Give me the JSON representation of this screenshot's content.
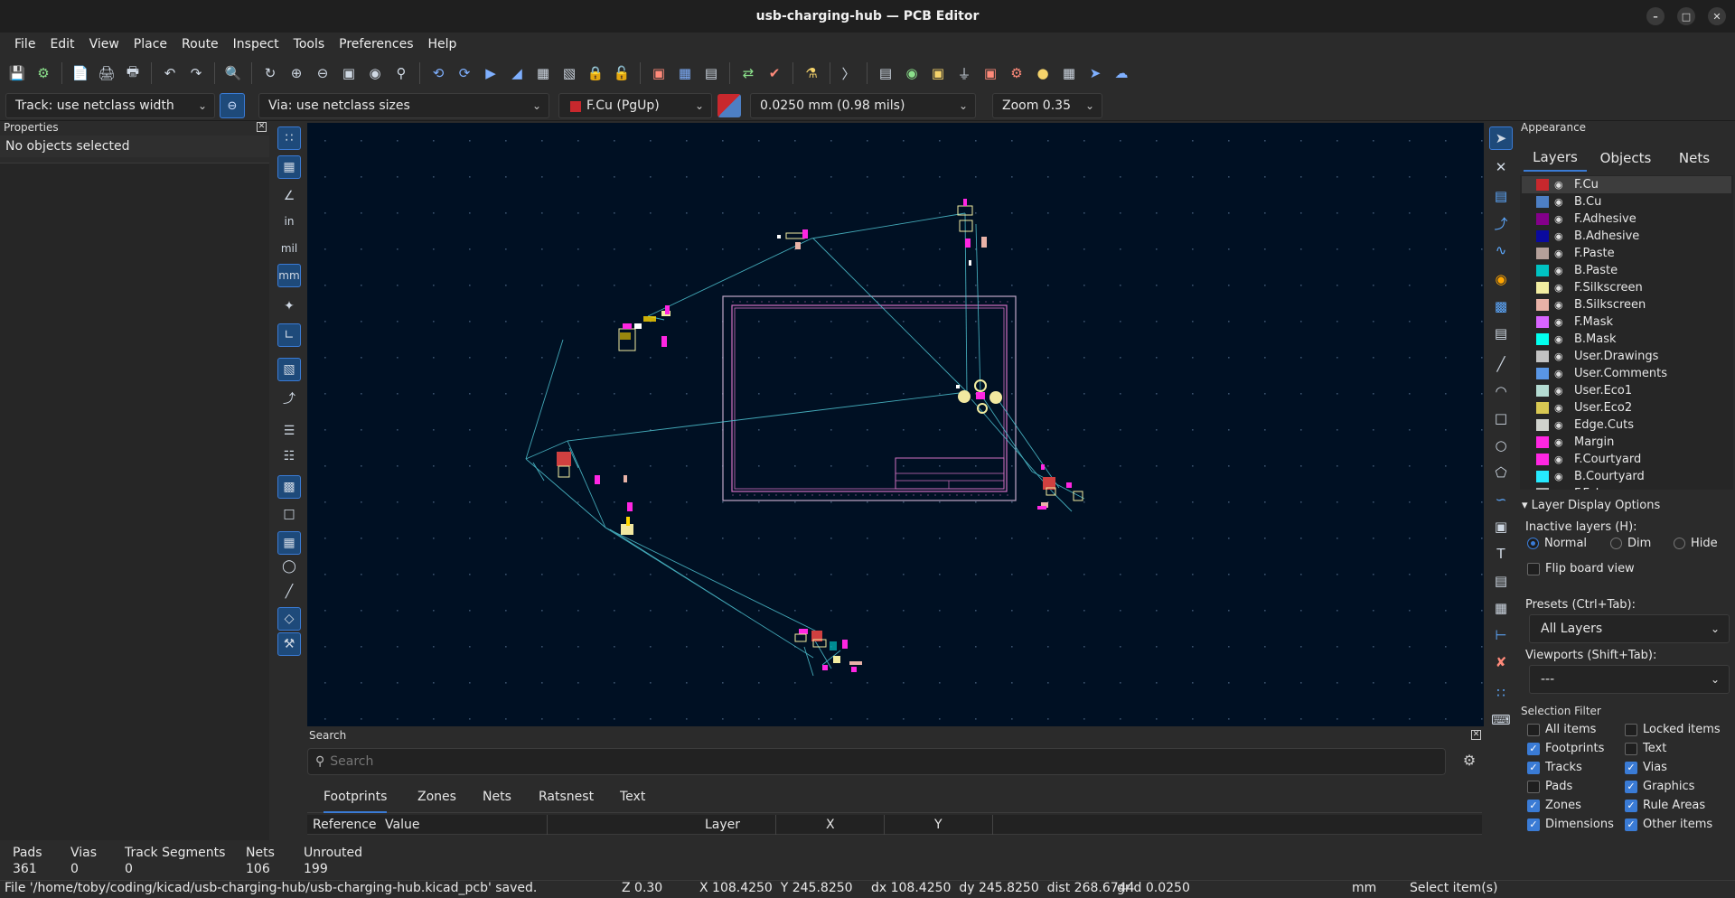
{
  "window": {
    "title": "usb-charging-hub — PCB Editor",
    "controls": [
      "minimize-icon",
      "maximize-icon",
      "close-icon"
    ]
  },
  "menu": [
    "File",
    "Edit",
    "View",
    "Place",
    "Route",
    "Inspect",
    "Tools",
    "Preferences",
    "Help"
  ],
  "toolbar2": {
    "track_width": "Track: use netclass width",
    "via_size": "Via: use netclass sizes",
    "layer": "F.Cu (PgUp)",
    "layer_color": "#c8282d",
    "grid": "0.0250 mm (0.98 mils)",
    "zoom": "Zoom 0.35"
  },
  "properties": {
    "title": "Properties",
    "empty_text": "No objects selected"
  },
  "left_tools": {
    "units": [
      "in",
      "mil",
      "mm"
    ]
  },
  "appearance": {
    "title": "Appearance",
    "tabs": [
      "Layers",
      "Objects",
      "Nets"
    ],
    "active_tab": "Layers",
    "layers": [
      {
        "name": "F.Cu",
        "color": "#c8282d"
      },
      {
        "name": "B.Cu",
        "color": "#4d7fc4"
      },
      {
        "name": "F.Adhesive",
        "color": "#84008a"
      },
      {
        "name": "B.Adhesive",
        "color": "#0a0a9e"
      },
      {
        "name": "F.Paste",
        "color": "#b4a09a"
      },
      {
        "name": "B.Paste",
        "color": "#00c2c2"
      },
      {
        "name": "F.Silkscreen",
        "color": "#f2eda1"
      },
      {
        "name": "B.Silkscreen",
        "color": "#e8b2a7"
      },
      {
        "name": "F.Mask",
        "color": "#d864ff"
      },
      {
        "name": "B.Mask",
        "color": "#02ffee"
      },
      {
        "name": "User.Drawings",
        "color": "#c2c2c2"
      },
      {
        "name": "User.Comments",
        "color": "#5996e5"
      },
      {
        "name": "User.Eco1",
        "color": "#b4dbd2"
      },
      {
        "name": "User.Eco2",
        "color": "#d8c852"
      },
      {
        "name": "Edge.Cuts",
        "color": "#d0d2cd"
      },
      {
        "name": "Margin",
        "color": "#ff26e2"
      },
      {
        "name": "F.Courtyard",
        "color": "#ff26e2"
      },
      {
        "name": "B.Courtyard",
        "color": "#26e9ff"
      },
      {
        "name": "F.Fab",
        "color": "#afafaf"
      }
    ],
    "layer_display_options": "Layer Display Options",
    "inactive_layers_label": "Inactive layers (H):",
    "inactive_options": [
      "Normal",
      "Dim",
      "Hide"
    ],
    "inactive_selected": "Normal",
    "flip_board_view": "Flip board view",
    "presets_label": "Presets (Ctrl+Tab):",
    "presets_value": "All Layers",
    "viewports_label": "Viewports (Shift+Tab):",
    "viewports_value": "---"
  },
  "selection_filter": {
    "title": "Selection Filter",
    "items": [
      {
        "label": "All items",
        "checked": false
      },
      {
        "label": "Locked items",
        "checked": false
      },
      {
        "label": "Footprints",
        "checked": true
      },
      {
        "label": "Text",
        "checked": false
      },
      {
        "label": "Tracks",
        "checked": true
      },
      {
        "label": "Vias",
        "checked": true
      },
      {
        "label": "Pads",
        "checked": false
      },
      {
        "label": "Graphics",
        "checked": true
      },
      {
        "label": "Zones",
        "checked": true
      },
      {
        "label": "Rule Areas",
        "checked": true
      },
      {
        "label": "Dimensions",
        "checked": true
      },
      {
        "label": "Other items",
        "checked": true
      }
    ]
  },
  "search": {
    "title": "Search",
    "placeholder": "Search",
    "tabs": [
      "Footprints",
      "Zones",
      "Nets",
      "Ratsnest",
      "Text"
    ],
    "active_tab": "Footprints",
    "columns": [
      "Reference",
      "Value",
      "Layer",
      "X",
      "Y"
    ]
  },
  "board_stats": {
    "labels": [
      "Pads",
      "Vias",
      "Track Segments",
      "Nets",
      "Unrouted"
    ],
    "values": [
      "361",
      "0",
      "0",
      "106",
      "199"
    ]
  },
  "status": {
    "message": "File '/home/toby/coding/kicad/usb-charging-hub/usb-charging-hub.kicad_pcb' saved.",
    "zoom": "Z 0.30",
    "coords": "X 108.4250  Y 245.8250",
    "delta": "dx 108.4250  dy 245.8250  dist 268.6744",
    "grid": "grid 0.0250",
    "units": "mm",
    "mode": "Select item(s)"
  }
}
